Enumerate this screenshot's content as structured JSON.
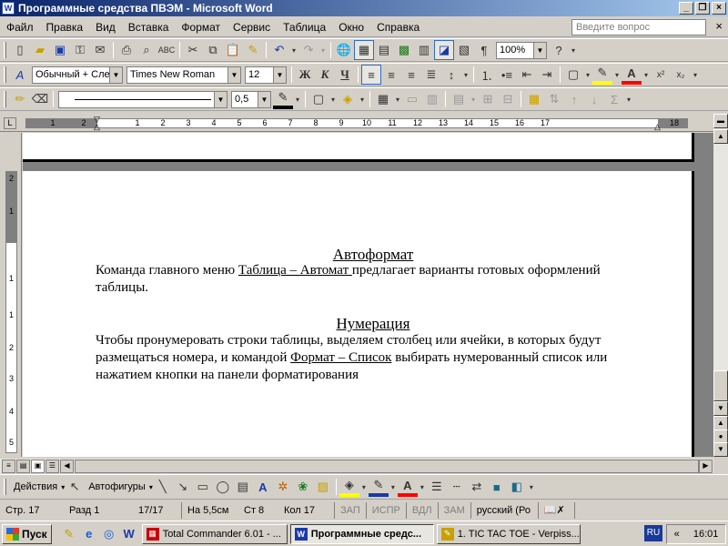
{
  "title": "Программные средства ПВЭМ - Microsoft Word",
  "app_icon": "W",
  "menu": [
    "Файл",
    "Правка",
    "Вид",
    "Вставка",
    "Формат",
    "Сервис",
    "Таблица",
    "Окно",
    "Справка"
  ],
  "help_placeholder": "Введите вопрос",
  "toolbar": {
    "zoom": "100%",
    "style": "Обычный + Сле",
    "font": "Times New Roman",
    "font_size": "12",
    "line_width": "0,5",
    "bold": "Ж",
    "italic": "К",
    "underline": "Ч",
    "help_q": "?",
    "pilcrow": "¶",
    "sigma": "Σ"
  },
  "ruler_h": [
    "1",
    "2",
    "1",
    "2",
    "3",
    "4",
    "5",
    "6",
    "7",
    "8",
    "9",
    "10",
    "11",
    "12",
    "13",
    "14",
    "15",
    "16",
    "17",
    "18"
  ],
  "ruler_v": [
    "2",
    "1",
    "1",
    "1",
    "2",
    "3",
    "4",
    "5",
    "6"
  ],
  "document": {
    "heading1": "Автоформат",
    "p1_a": "Команда главного меню ",
    "p1_link": "Таблица – Автомат ",
    "p1_b": "предлагает варианты готовых оформлений таблицы.",
    "heading2": "Нумерация",
    "p2_a": "Чтобы пронумеровать строки таблицы, выделяем столбец или ячейки, в которых будут размещаться номера, и командой ",
    "p2_link": "Формат – Список",
    "p2_b": " выбирать нумерованный список или нажатием кнопки на панели форматирования"
  },
  "drawbar": {
    "actions": "Действия",
    "autoshapes": "Автофигуры"
  },
  "status": {
    "page": "Стр.  17",
    "section": "Разд  1",
    "pages": "17/17",
    "at": "На 5,5см",
    "line": "Ст  8",
    "col": "Кол  17",
    "rec": "ЗАП",
    "trk": "ИСПР",
    "ext": "ВДЛ",
    "ovr": "ЗАМ",
    "lang": "русский (Ро"
  },
  "taskbar": {
    "start": "Пуск",
    "tasks": [
      "Total Commander 6.01 - ...",
      "Программные средс...",
      "1. TIC TAC TOE - Verpiss..."
    ],
    "lang": "RU",
    "tray_arrow": "«",
    "clock": "16:01"
  },
  "colors": {
    "titlebar": "#0a246a",
    "highlight": "#ffff00",
    "font_color": "#ff0000"
  }
}
